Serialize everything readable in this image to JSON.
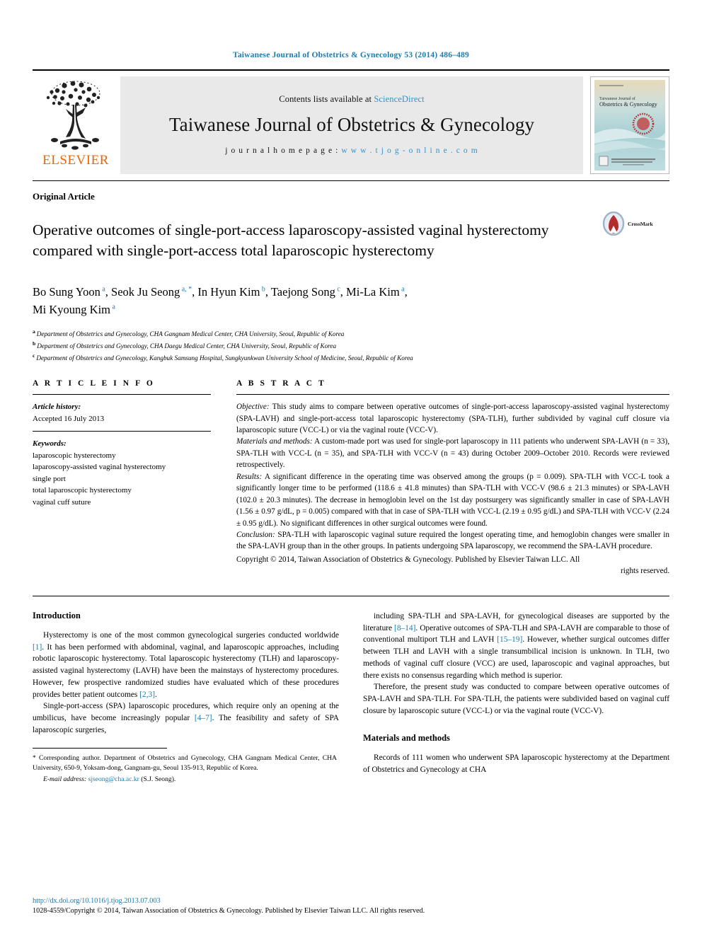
{
  "running_head": "Taiwanese Journal of Obstetrics & Gynecology 53 (2014) 486–489",
  "masthead": {
    "publisher_name": "ELSEVIER",
    "contents_prefix": "Contents lists available at ",
    "sciencedirect": "ScienceDirect",
    "journal_title": "Taiwanese Journal of Obstetrics & Gynecology",
    "homepage_label": "j o u r n a l   h o m e p a g e :  ",
    "homepage_url": "w w w . t j o g - o n l i n e . c o m",
    "cover_line1": "Taiwanese Journal of",
    "cover_line2": "Obstetrics & Gynecology",
    "link_color": "#2f93d1"
  },
  "article": {
    "type": "Original Article",
    "title": "Operative outcomes of single-port-access laparoscopy-assisted vaginal hysterectomy compared with single-port-access total laparoscopic hysterectomy",
    "crossmark_label": "CrossMark",
    "authors_line1_parts": [
      {
        "name": "Bo Sung Yoon",
        "sup": "a"
      },
      {
        "name": "Seok Ju Seong",
        "sup": "a, *"
      },
      {
        "name": "In Hyun Kim",
        "sup": "b"
      },
      {
        "name": "Taejong Song",
        "sup": "c"
      },
      {
        "name": "Mi-La Kim",
        "sup": "a"
      }
    ],
    "authors_line2_parts": [
      {
        "name": "Mi Kyoung Kim",
        "sup": "a"
      }
    ],
    "affiliations": [
      {
        "sup": "a",
        "text": "Department of Obstetrics and Gynecology, CHA Gangnam Medical Center, CHA University, Seoul, Republic of Korea"
      },
      {
        "sup": "b",
        "text": "Department of Obstetrics and Gynecology, CHA Daegu Medical Center, CHA University, Seoul, Republic of Korea"
      },
      {
        "sup": "c",
        "text": "Department of Obstetrics and Gynecology, Kangbuk Samsung Hospital, Sungkyunkwan University School of Medicine, Seoul, Republic of Korea"
      }
    ]
  },
  "article_info": {
    "heading": "A R T I C L E   I N F O",
    "history_label": "Article history:",
    "history_value": "Accepted 16 July 2013",
    "keywords_label": "Keywords:",
    "keywords": [
      "laparoscopic hysterectomy",
      "laparoscopy-assisted vaginal hysterectomy",
      "single port",
      "total laparoscopic hysterectomy",
      "vaginal cuff suture"
    ]
  },
  "abstract": {
    "heading": "A B S T R A C T",
    "sections": [
      {
        "label": "Objective:",
        "text": " This study aims to compare between operative outcomes of single-port-access laparoscopy-assisted vaginal hysterectomy (SPA-LAVH) and single-port-access total laparoscopic hysterectomy (SPA-TLH), further subdivided by vaginal cuff closure via laparoscopic suture (VCC-L) or via the vaginal route (VCC-V)."
      },
      {
        "label": "Materials and methods:",
        "text": " A custom-made port was used for single-port laparoscopy in 111 patients who underwent SPA-LAVH (n = 33), SPA-TLH with VCC-L (n = 35), and SPA-TLH with VCC-V (n = 43) during October 2009–October 2010. Records were reviewed retrospectively."
      },
      {
        "label": "Results:",
        "text": " A significant difference in the operating time was observed among the groups (p = 0.009). SPA-TLH with VCC-L took a significantly longer time to be performed (118.6 ± 41.8 minutes) than SPA-TLH with VCC-V (98.6 ± 21.3 minutes) or SPA-LAVH (102.0 ± 20.3 minutes). The decrease in hemoglobin level on the 1st day postsurgery was significantly smaller in case of SPA-LAVH (1.56 ± 0.97 g/dL, p = 0.005) compared with that in case of SPA-TLH with VCC-L (2.19 ± 0.95 g/dL) and SPA-TLH with VCC-V (2.24 ± 0.95 g/dL). No significant differences in other surgical outcomes were found."
      },
      {
        "label": "Conclusion:",
        "text": " SPA-TLH with laparoscopic vaginal suture required the longest operating time, and hemoglobin changes were smaller in the SPA-LAVH group than in the other groups. In patients undergoing SPA laparoscopy, we recommend the SPA-LAVH procedure."
      }
    ],
    "copyright_main": "Copyright © 2014, Taiwan Association of Obstetrics & Gynecology. Published by Elsevier Taiwan LLC. All",
    "copyright_tail": "rights reserved."
  },
  "body": {
    "left_column": {
      "heading": "Introduction",
      "paragraphs": [
        "Hysterectomy is one of the most common gynecological surgeries conducted worldwide [1]. It has been performed with abdominal, vaginal, and laparoscopic approaches, including robotic laparoscopic hysterectomy. Total laparoscopic hysterectomy (TLH) and laparoscopy-assisted vaginal hysterectomy (LAVH) have been the mainstays of hysterectomy procedures. However, few prospective randomized studies have evaluated which of these procedures provides better patient outcomes [2,3].",
        "Single-port-access (SPA) laparoscopic procedures, which require only an opening at the umbilicus, have become increasingly popular [4–7]. The feasibility and safety of SPA laparoscopic surgeries,"
      ]
    },
    "right_column": {
      "paragraphs": [
        "including SPA-TLH and SPA-LAVH, for gynecological diseases are supported by the literature [8–14]. Operative outcomes of SPA-TLH and SPA-LAVH are comparable to those of conventional multiport TLH and LAVH [15–19]. However, whether surgical outcomes differ between TLH and LAVH with a single transumbilical incision is unknown. In TLH, two methods of vaginal cuff closure (VCC) are used, laparoscopic and vaginal approaches, but there exists no consensus regarding which method is superior.",
        "Therefore, the present study was conducted to compare between operative outcomes of SPA-LAVH and SPA-TLH. For SPA-TLH, the patients were subdivided based on vaginal cuff closure by laparoscopic suture (VCC-L) or via the vaginal route (VCC-V)."
      ],
      "heading2": "Materials and methods",
      "paragraphs2": [
        "Records of 111 women who underwent SPA laparoscopic hysterectomy at the Department of Obstetrics and Gynecology at CHA"
      ]
    }
  },
  "footnotes": {
    "corresponding": "* Corresponding author. Department of Obstetrics and Gynecology, CHA Gangnam Medical Center, CHA University, 650-9, Yoksam-dong, Gangnam-gu, Seoul 135-913, Republic of Korea.",
    "email_label": "E-mail address:",
    "email_address": "sjseong@cha.ac.kr",
    "email_suffix": "(S.J. Seong)."
  },
  "page_footer": {
    "doi": "http://dx.doi.org/10.1016/j.tjog.2013.07.003",
    "issn_copyright": "1028-4559/Copyright © 2014, Taiwan Association of Obstetrics & Gynecology. Published by Elsevier Taiwan LLC. All rights reserved."
  }
}
